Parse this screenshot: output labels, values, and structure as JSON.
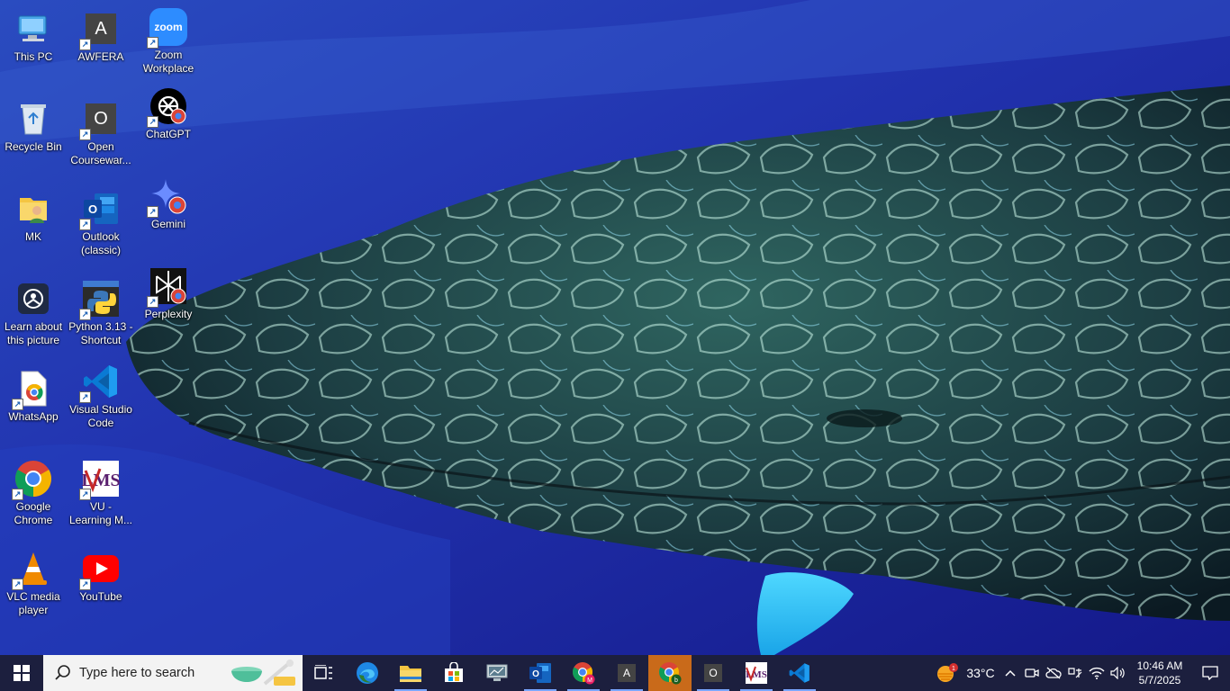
{
  "desktop": {
    "icons": [
      {
        "label": "This PC"
      },
      {
        "label": "Recycle Bin"
      },
      {
        "label": "MK"
      },
      {
        "label": "Learn about this picture"
      },
      {
        "label": "WhatsApp"
      },
      {
        "label": "Google Chrome"
      },
      {
        "label": "VLC media player"
      },
      {
        "label": "AWFERA",
        "glyph": "A"
      },
      {
        "label": "Open Coursewar...",
        "glyph": "O"
      },
      {
        "label": "Outlook (classic)"
      },
      {
        "label": "Python 3.13 - Shortcut"
      },
      {
        "label": "Visual Studio Code"
      },
      {
        "label": "VU - Learning M..."
      },
      {
        "label": "YouTube"
      },
      {
        "label": "Zoom Workplace",
        "glyph": "zoom"
      },
      {
        "label": "ChatGPT"
      },
      {
        "label": "Gemini"
      },
      {
        "label": "Perplexity"
      }
    ]
  },
  "taskbar": {
    "search_placeholder": "Type here to search",
    "apps": [
      {
        "name": "Task View",
        "icon": "task-view-icon"
      },
      {
        "name": "Microsoft Edge",
        "icon": "edge-icon"
      },
      {
        "name": "File Explorer",
        "icon": "folder-icon"
      },
      {
        "name": "Microsoft Store",
        "icon": "store-icon"
      },
      {
        "name": "Remote Desktop",
        "icon": "remote-desktop-icon"
      },
      {
        "name": "Outlook",
        "icon": "outlook-icon"
      },
      {
        "name": "Chrome (M)",
        "icon": "chrome-icon"
      },
      {
        "name": "AWFERA",
        "icon": "awfera-icon",
        "glyph": "A"
      },
      {
        "name": "Chrome (b)",
        "icon": "chrome-icon"
      },
      {
        "name": "Open Courseware",
        "icon": "open-courseware-icon",
        "glyph": "O"
      },
      {
        "name": "VU LMS",
        "icon": "vu-lms-icon"
      },
      {
        "name": "Visual Studio Code",
        "icon": "vscode-icon"
      }
    ],
    "chrome_profile_badges": [
      "M",
      "b"
    ],
    "weather": {
      "temperature": "33°C",
      "alert_count": "1"
    },
    "clock": {
      "time": "10:46 AM",
      "date": "5/7/2025"
    }
  },
  "colors": {
    "taskbar_bg": "#1c1f3e",
    "highlight_bg": "#c96a1a",
    "ocean_deep": "#1a2a9a",
    "whale": "#1c3b3f"
  }
}
